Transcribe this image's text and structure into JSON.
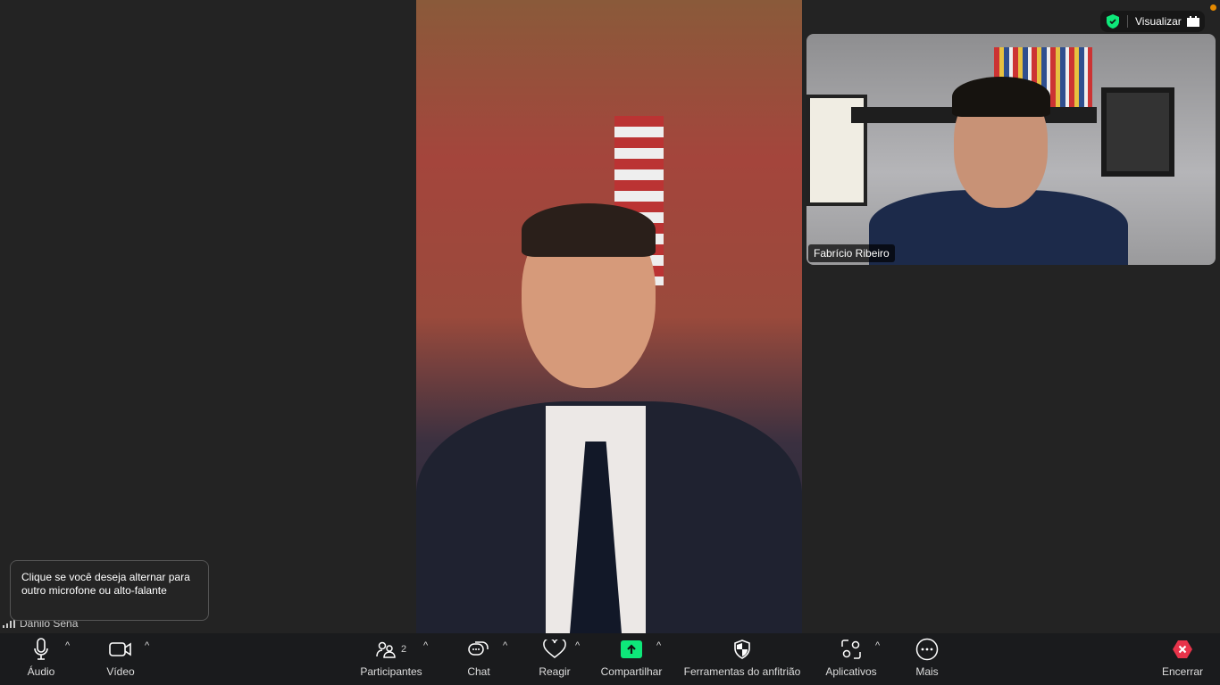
{
  "main_video": {
    "participant": "Danilo Sena"
  },
  "thumbnail": {
    "participant_name": "Fabrício Ribeiro"
  },
  "topbar": {
    "security_icon": "shield-check-icon",
    "view_label": "Visualizar",
    "view_icon": "grid-icon",
    "status_color": "#e58a00"
  },
  "tooltip": {
    "text": "Clique se você deseja alternar para outro microfone ou alto-falante"
  },
  "self": {
    "name": "Danilo Sena"
  },
  "toolbar": {
    "audio": "Áudio",
    "video": "Vídeo",
    "participants": "Participantes",
    "participants_count": "2",
    "chat": "Chat",
    "react": "Reagir",
    "share": "Compartilhar",
    "host_tools": "Ferramentas do anfitrião",
    "apps": "Aplicativos",
    "more": "Mais",
    "end": "Encerrar",
    "share_color": "#0ee87a",
    "end_color": "#e8334a"
  }
}
